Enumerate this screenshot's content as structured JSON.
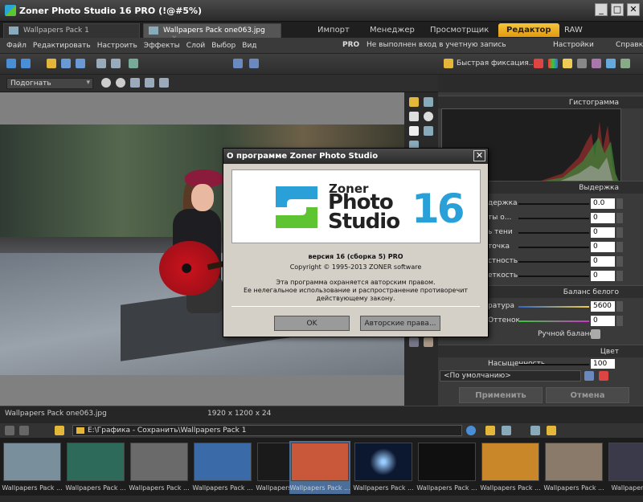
{
  "window": {
    "title": "Zoner Photo Studio 16 PRO  (!@#5%)"
  },
  "doc_tabs": [
    {
      "label": "Wallpapers Pack 1"
    },
    {
      "label": "Wallpapers Pack one063.jpg"
    }
  ],
  "mode_tabs": [
    {
      "label": "Импорт"
    },
    {
      "label": "Менеджер"
    },
    {
      "label": "Просмотрщик"
    },
    {
      "label": "Редактор",
      "active": true
    },
    {
      "label": "RAW"
    }
  ],
  "menu": {
    "items": [
      "Файл",
      "Редактировать",
      "Настроить",
      "Эффекты",
      "Слой",
      "Выбор",
      "Вид"
    ],
    "pro": "PRO",
    "login": "Не выполнен вход в учетную запись",
    "settings": "Настройки",
    "help": "Справка"
  },
  "toolbar": {
    "quickfix": "Быстрая фиксация..."
  },
  "zoom": {
    "value": "Подогнать"
  },
  "panel": {
    "histogram": "Гистограмма",
    "exposure": "Выдержка",
    "exposure_rows": [
      {
        "label": "держка",
        "value": "0.0"
      },
      {
        "label": "ты о...",
        "value": "0"
      },
      {
        "label": "ь тени",
        "value": "0"
      },
      {
        "label": "точка",
        "value": "0"
      },
      {
        "label": "стность",
        "value": "0"
      },
      {
        "label": "еткость",
        "value": "0"
      }
    ],
    "white_balance": "Баланс белого",
    "wb_rows": [
      {
        "label": "ратура",
        "value": "5600"
      },
      {
        "label": "Оттенок",
        "value": "0"
      }
    ],
    "manual_balance": "Ручной баланс",
    "color": "Цвет",
    "color_row": {
      "label": "Насыщенность",
      "value": "100"
    },
    "preset": "<По умолчанию>",
    "apply": "Применить",
    "cancel": "Отмена"
  },
  "status": {
    "filename": "Wallpapers Pack one063.jpg",
    "dimensions": "1920 x 1200 x 24"
  },
  "browser": {
    "path": "E:\\Графика - Сохранить\\Wallpapers Pack 1"
  },
  "thumbnails": [
    {
      "label": "Wallpapers Pack ...",
      "color": "#7a8f9c"
    },
    {
      "label": "Wallpapers Pack ...",
      "color": "#2e6a5a"
    },
    {
      "label": "Wallpapers Pack ...",
      "color": "#6a6a6a"
    },
    {
      "label": "Wallpapers Pack ...",
      "color": "#3a6aa8"
    },
    {
      "label": "Wallpapers Pack ...",
      "color": "#1a1a1a"
    },
    {
      "label": "Wallpapers Pack ...",
      "color": "#c9573a",
      "selected": true
    },
    {
      "label": "Wallpapers Pack ...",
      "color": "#0c1830"
    },
    {
      "label": "Wallpapers Pack ...",
      "color": "#101010"
    },
    {
      "label": "Wallpapers Pack ...",
      "color": "#c9872a"
    },
    {
      "label": "Wallpapers Pack ...",
      "color": "#8a7a6a"
    },
    {
      "label": "Wallpapers Pack",
      "color": "#3a3a4a"
    }
  ],
  "dialog": {
    "title": "О программе Zoner Photo Studio",
    "logo": {
      "zoner": "Zoner",
      "photo": "Photo",
      "studio": "Studio",
      "number": "16"
    },
    "version": "версия 16 (сборка 5) PRO",
    "copyright": "Copyright © 1995-2013 ZONER software",
    "legal1": "Эта программа охраняется авторским правом.",
    "legal2": "Ее нелегальное использование и распространение противоречит",
    "legal3": "действующему закону.",
    "ok": "OK",
    "rights": "Авторские права..."
  },
  "colors": {
    "accent": "#f0b020",
    "logo_blue": "#2aa0d8",
    "logo_green": "#5fc431"
  }
}
